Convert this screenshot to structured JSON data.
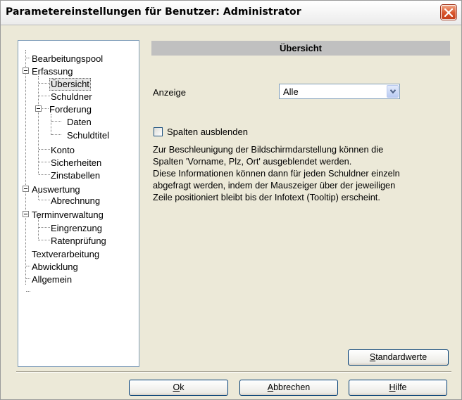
{
  "window": {
    "title": "Parametereinstellungen für Benutzer: Administrator"
  },
  "tree": {
    "items": [
      {
        "label": "Bearbeitungspool"
      },
      {
        "label": "Erfassung"
      },
      {
        "label": "Übersicht"
      },
      {
        "label": "Schuldner"
      },
      {
        "label": "Forderung"
      },
      {
        "label": "Daten"
      },
      {
        "label": "Schuldtitel"
      },
      {
        "label": "Konto"
      },
      {
        "label": "Sicherheiten"
      },
      {
        "label": "Zinstabellen"
      },
      {
        "label": "Auswertung"
      },
      {
        "label": "Abrechnung"
      },
      {
        "label": "Terminverwaltung"
      },
      {
        "label": "Eingrenzung"
      },
      {
        "label": "Ratenprüfung"
      },
      {
        "label": "Textverarbeitung"
      },
      {
        "label": "Abwicklung"
      },
      {
        "label": "Allgemein"
      }
    ],
    "selected": "Übersicht"
  },
  "panel": {
    "header": "Übersicht",
    "anzeige_label": "Anzeige",
    "anzeige_value": "Alle",
    "checkbox_label": "Spalten ausblenden",
    "checkbox_checked": false,
    "description_lines": [
      "Zur Beschleunigung der Bildschirmdarstellung können die",
      "Spalten 'Vorname, Plz, Ort' ausgeblendet werden.",
      "Diese Informationen können dann für jeden Schuldner einzeln",
      "abgefragt werden, indem der Mauszeiger über der jeweiligen",
      "Zeile positioniert bleibt bis der Infotext (Tooltip) erscheint."
    ],
    "standard_button": {
      "mnemonic": "S",
      "rest": "tandardwerte"
    }
  },
  "footer": {
    "ok": {
      "mnemonic": "O",
      "rest": "k"
    },
    "cancel": {
      "mnemonic": "A",
      "rest": "bbrechen"
    },
    "help": {
      "mnemonic": "H",
      "rest": "ilfe"
    }
  }
}
